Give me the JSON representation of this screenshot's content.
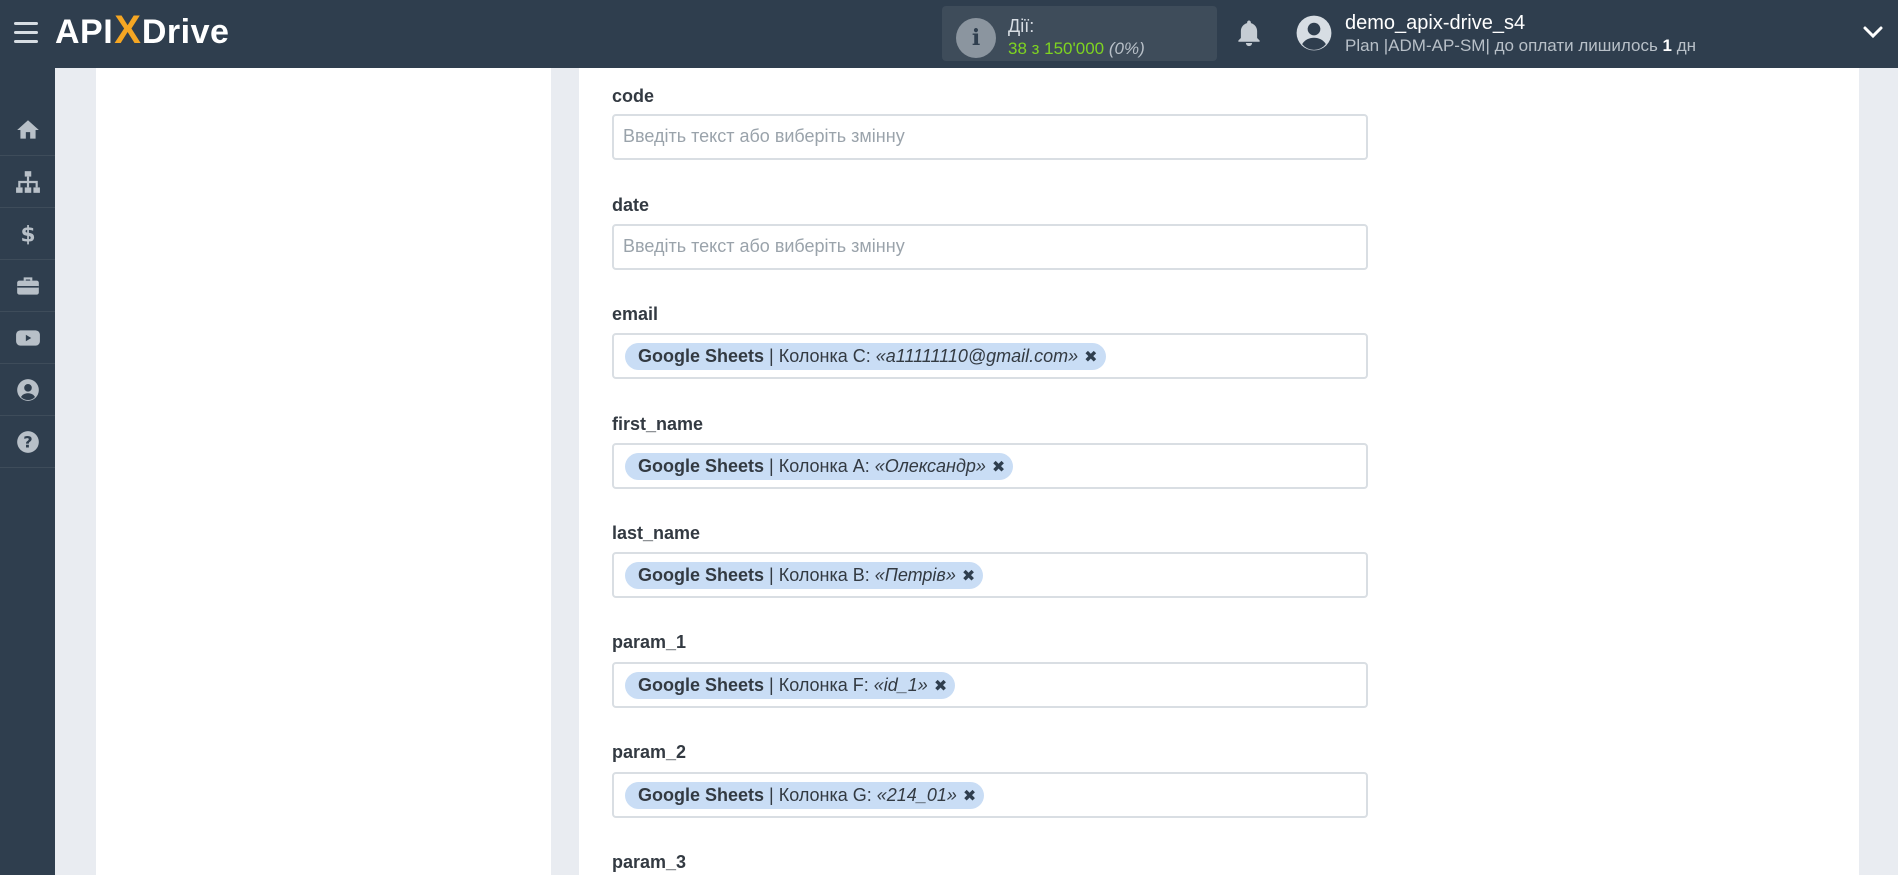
{
  "header": {
    "logo": {
      "part1": "API",
      "part2": "X",
      "part3": "Drive"
    },
    "actions": {
      "label": "Дії:",
      "count": "38 з 150'000",
      "percent": "(0%)"
    },
    "user": {
      "name": "demo_apix-drive_s4",
      "plan_prefix": "Plan |ADM-AP-SM| до оплати лишилось ",
      "plan_days": "1",
      "plan_suffix": " дн"
    }
  },
  "sidebar": {
    "items": [
      {
        "icon": "home-icon"
      },
      {
        "icon": "sitemap-icon"
      },
      {
        "icon": "dollar-icon"
      },
      {
        "icon": "briefcase-icon"
      },
      {
        "icon": "youtube-icon"
      },
      {
        "icon": "user-circle-icon"
      },
      {
        "icon": "question-circle-icon"
      }
    ]
  },
  "form": {
    "placeholder": "Введіть текст або виберіть змінну",
    "fields": [
      {
        "label": "code"
      },
      {
        "label": "date"
      },
      {
        "label": "email",
        "chip": {
          "source": "Google Sheets",
          "separator": "|",
          "column": "Колонка C:",
          "value": "«a11111110@gmail.com»"
        }
      },
      {
        "label": "first_name",
        "chip": {
          "source": "Google Sheets",
          "separator": "|",
          "column": "Колонка A:",
          "value": "«Олександр»"
        }
      },
      {
        "label": "last_name",
        "chip": {
          "source": "Google Sheets",
          "separator": "|",
          "column": "Колонка B:",
          "value": "«Петрів»"
        }
      },
      {
        "label": "param_1",
        "chip": {
          "source": "Google Sheets",
          "separator": "|",
          "column": "Колонка F:",
          "value": "«id_1»"
        }
      },
      {
        "label": "param_2",
        "chip": {
          "source": "Google Sheets",
          "separator": "|",
          "column": "Колонка G:",
          "value": "«214_01»"
        }
      },
      {
        "label": "param_3"
      }
    ]
  },
  "colors": {
    "topbar": "#2f3e4e",
    "accent": "#f5a623",
    "chip": "#c9ddf5",
    "actions_count": "#7ed321"
  }
}
